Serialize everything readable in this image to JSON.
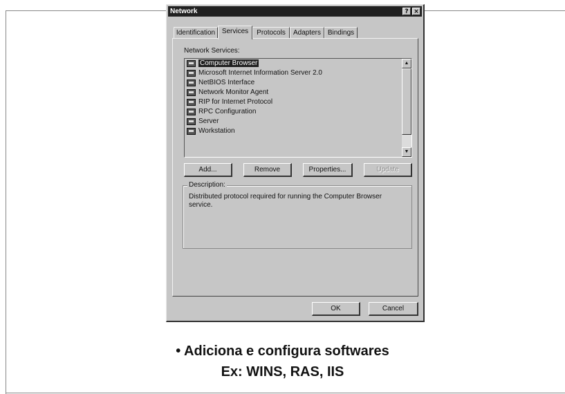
{
  "window": {
    "title": "Network",
    "help_glyph": "?",
    "close_glyph": "×"
  },
  "tabs": [
    "Identification",
    "Services",
    "Protocols",
    "Adapters",
    "Bindings"
  ],
  "active_tab": "Services",
  "services_label": "Network Services:",
  "services": [
    "Computer Browser",
    "Microsoft Internet Information Server 2.0",
    "NetBIOS Interface",
    "Network Monitor Agent",
    "RIP for Internet Protocol",
    "RPC Configuration",
    "Server",
    "Workstation"
  ],
  "selected_service": "Computer Browser",
  "scrollbar": {
    "up_glyph": "▲",
    "down_glyph": "▼"
  },
  "buttons": {
    "add": "Add...",
    "remove": "Remove",
    "properties": "Properties...",
    "update": "Update"
  },
  "description": {
    "legend": "Description:",
    "text": "Distributed protocol required for running the Computer Browser service."
  },
  "footer": {
    "ok": "OK",
    "cancel": "Cancel"
  },
  "caption": {
    "line1": "• Adiciona e configura softwares",
    "line2": "Ex: WINS, RAS, IIS"
  }
}
